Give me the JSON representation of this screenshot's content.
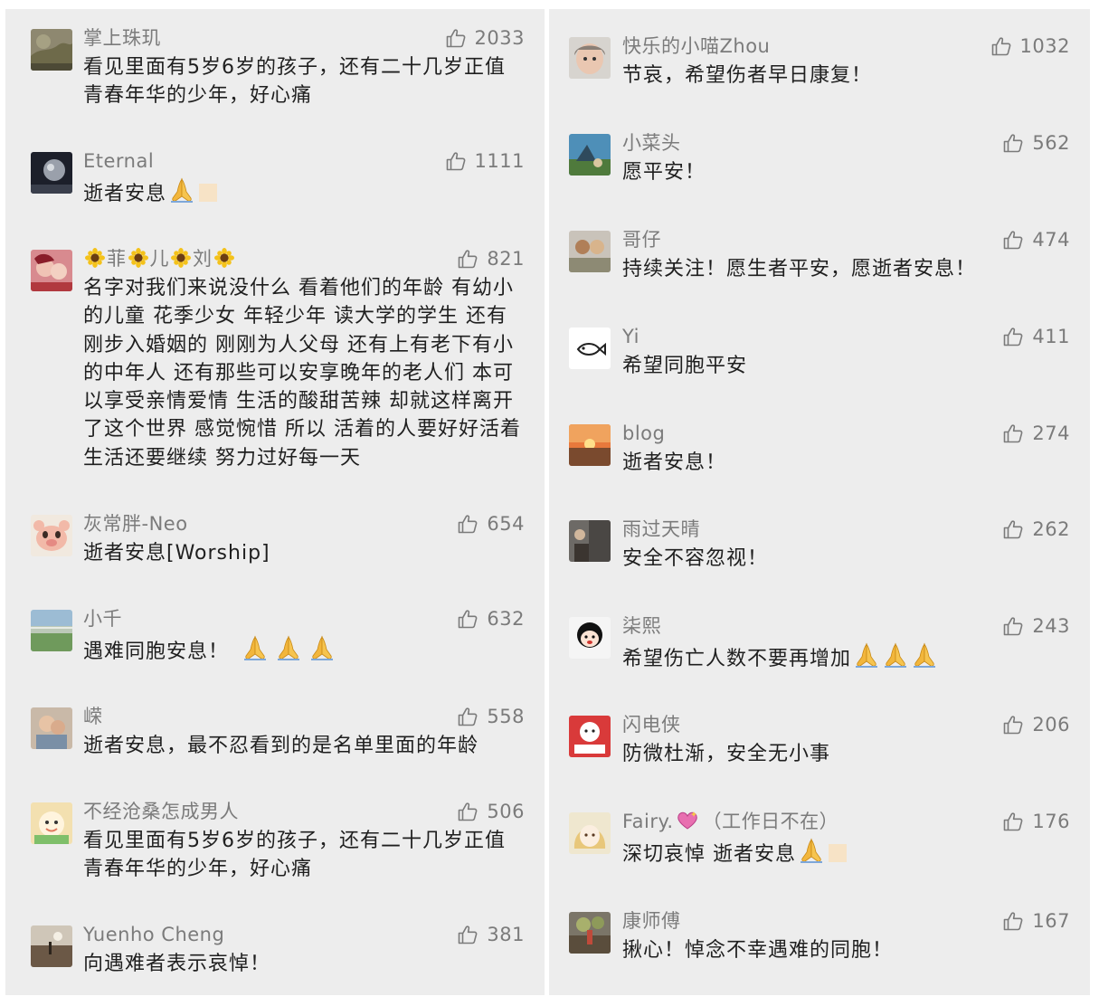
{
  "left": {
    "comments": [
      {
        "name": "掌上珠玑",
        "likes": "2033",
        "text": "看见里面有5岁6岁的孩子，还有二十几岁正值青春年华的少年，好心痛"
      },
      {
        "name": "Eternal",
        "likes": "1111",
        "text": "逝者安息"
      },
      {
        "name_parts": [
          "菲",
          "儿",
          "刘"
        ],
        "likes": "821",
        "text": "名字对我们来说没什么 看着他们的年龄 有幼小的儿童 花季少女 年轻少年 读大学的学生 还有刚步入婚姻的 刚刚为人父母  还有上有老下有小的中年人 还有那些可以安享晚年的老人们 本可以享受亲情爱情 生活的酸甜苦辣 却就这样离开了这个世界 感觉惋惜 所以 活着的人要好好活着 生活还要继续 努力过好每一天"
      },
      {
        "name": "灰常胖-Neo",
        "likes": "654",
        "text": "逝者安息[Worship]"
      },
      {
        "name": "小千",
        "likes": "632",
        "text": "遇难同胞安息！"
      },
      {
        "name": "嵘",
        "likes": "558",
        "text": "逝者安息，最不忍看到的是名单里面的年龄"
      },
      {
        "name": "不经沧桑怎成男人",
        "likes": "506",
        "text": "看见里面有5岁6岁的孩子，还有二十几岁正值青春年华的少年，好心痛"
      },
      {
        "name": "Yuenho Cheng",
        "likes": "381",
        "text": "向遇难者表示哀悼！"
      }
    ]
  },
  "right": {
    "comments": [
      {
        "name": "快乐的小喵Zhou",
        "likes": "1032",
        "text": "节哀，希望伤者早日康复！"
      },
      {
        "name": "小菜头",
        "likes": "562",
        "text": "愿平安！"
      },
      {
        "name": "哥仔",
        "likes": "474",
        "text": "持续关注！愿生者平安，愿逝者安息！"
      },
      {
        "name": "Yi",
        "likes": "411",
        "text": "希望同胞平安"
      },
      {
        "name": "blog",
        "likes": "274",
        "text": "逝者安息！"
      },
      {
        "name": "雨过天晴",
        "likes": "262",
        "text": "安全不容忽视！"
      },
      {
        "name": "柒熙",
        "likes": "243",
        "text": "希望伤亡人数不要再增加"
      },
      {
        "name": "闪电侠",
        "likes": "206",
        "text": "防微杜渐，安全无小事"
      },
      {
        "name_parts": [
          "Fairy.",
          "（工作日不在）"
        ],
        "likes": "176",
        "text": "深切哀悼 逝者安息"
      },
      {
        "name": "康师傅",
        "likes": "167",
        "text": "揪心！悼念不幸遇难的同胞！"
      }
    ]
  },
  "icons": {
    "like": "thumbs-up-icon",
    "pray": "pray-hands-emoji",
    "sunflower": "sunflower-emoji",
    "heart": "sparkling-heart-emoji"
  },
  "colors": {
    "background": "#ededed",
    "meta_text": "#7b7b7b",
    "body_text": "#1f1f1f"
  }
}
